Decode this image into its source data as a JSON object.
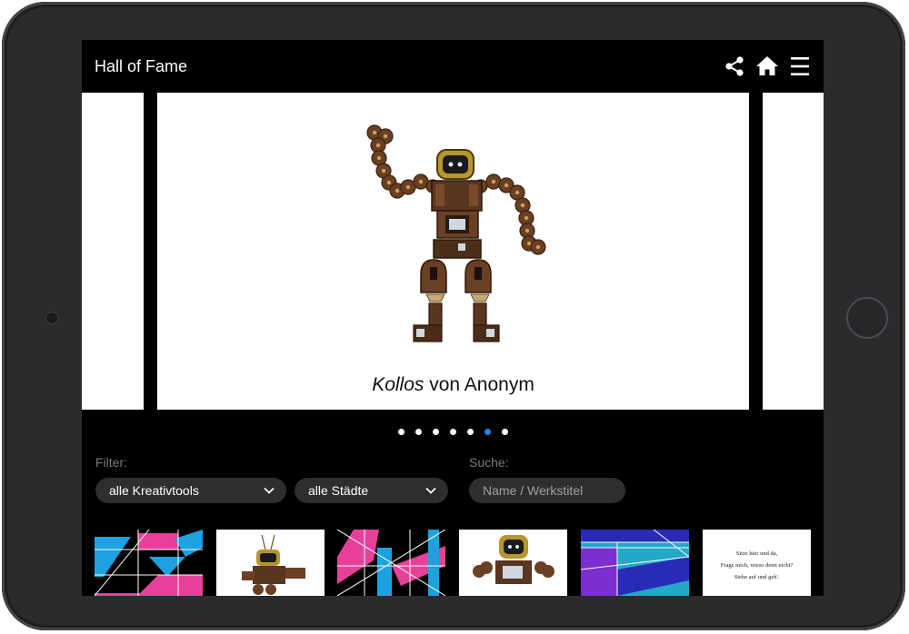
{
  "header": {
    "title": "Hall of Fame",
    "icons": [
      "share-icon",
      "home-icon",
      "menu-icon"
    ]
  },
  "carousel": {
    "work_title": "Kollos",
    "by_artist": "von Anonym",
    "page_count": 7,
    "active_index": 5,
    "active_color": "#1e88e5"
  },
  "filter": {
    "label": "Filter:",
    "tool_select": "alle Kreativtools",
    "city_select": "alle Städte"
  },
  "search": {
    "label": "Suche:",
    "placeholder": "Name / Werkstitel"
  },
  "thumbnails": [
    {
      "kind": "geometric",
      "palette": [
        "#1da1e0",
        "#e8409a",
        "#000000"
      ]
    },
    {
      "kind": "robot"
    },
    {
      "kind": "geometric",
      "palette": [
        "#e8409a",
        "#1da1e0",
        "#000000"
      ]
    },
    {
      "kind": "robot"
    },
    {
      "kind": "geometric",
      "palette": [
        "#2a2ab8",
        "#23a8c8",
        "#7b2fd0"
      ]
    },
    {
      "kind": "poem",
      "lines": [
        "Sitze hier und da,",
        "Frage mich, wieso denn nicht?",
        "Stehe auf und geh'."
      ]
    }
  ]
}
